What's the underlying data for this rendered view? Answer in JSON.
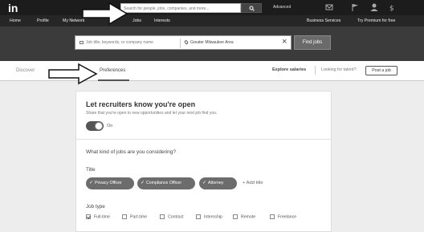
{
  "topbar": {
    "logo": "in",
    "search_placeholder": "Search for people, jobs, companies, and more...",
    "advanced_label": "Advanced",
    "icons": [
      "search-icon",
      "messages-icon",
      "notifications-flag-icon",
      "profile-icon",
      "account-icon"
    ]
  },
  "nav": {
    "items": [
      "Home",
      "Profile",
      "My Network",
      "Jobs",
      "Interests"
    ],
    "right_items": [
      "Business Services",
      "Try Premium for free"
    ]
  },
  "job_search": {
    "keyword_placeholder": "Job title, keywords, or company name",
    "location_value": "Greater Milwaukee Area",
    "find_button": "Find jobs"
  },
  "tabs": {
    "items": [
      "Discover",
      "Preferences"
    ],
    "active": "Preferences",
    "explore_salaries": "Explore salaries",
    "looking_for_talent": "Looking for talent?",
    "post_job": "Post a job"
  },
  "preferences_card": {
    "title": "Let recruiters know you're open",
    "subtitle": "Share that you're open to new opportunities and let your next job find you.",
    "toggle_state": "On",
    "question": "What kind of jobs are you considering?",
    "title_label": "Title",
    "titles": [
      "Privacy Officer",
      "Compliance Officer",
      "Attorney"
    ],
    "add_title": "+ Add title",
    "job_type_label": "Job type",
    "job_types": [
      {
        "label": "Full-time",
        "checked": true
      },
      {
        "label": "Part-time",
        "checked": false
      },
      {
        "label": "Contract",
        "checked": false
      },
      {
        "label": "Internship",
        "checked": false
      },
      {
        "label": "Remote",
        "checked": false
      },
      {
        "label": "Freelance",
        "checked": false
      }
    ]
  },
  "colors": {
    "topbar_bg": "#1c1c1c",
    "navbar_bg": "#262626",
    "hero_bg": "#3b3b3b",
    "chip_bg": "#6c6c6c",
    "page_bg": "#ededed"
  }
}
